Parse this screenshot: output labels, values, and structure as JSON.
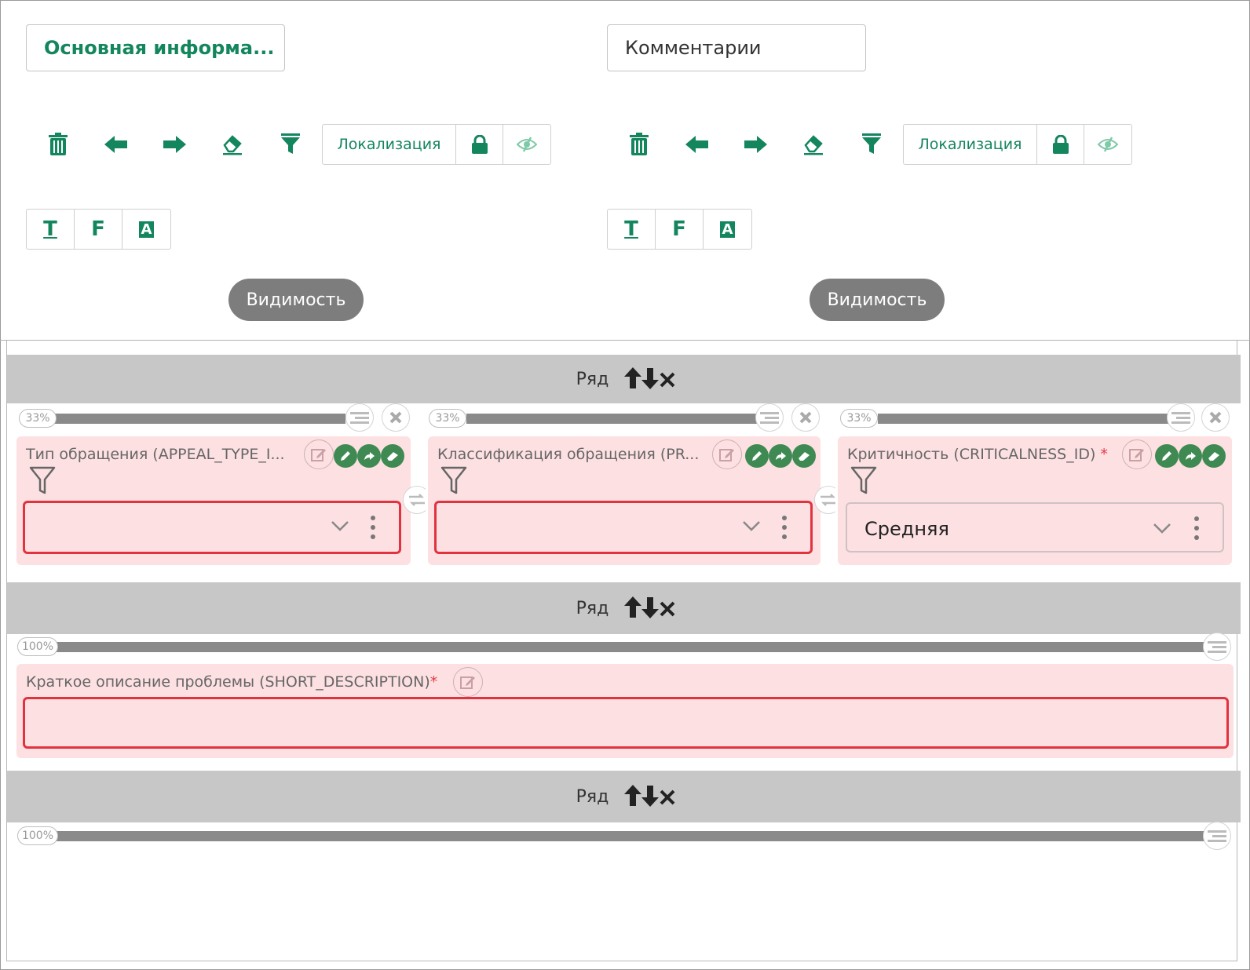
{
  "panels": [
    {
      "tab_label": "Основная информа...",
      "active": true,
      "localization_label": "Локализация",
      "visibility_label": "Видимость"
    },
    {
      "tab_label": "Комментарии",
      "active": false,
      "localization_label": "Локализация",
      "visibility_label": "Видимость"
    }
  ],
  "format_buttons": {
    "text": "T",
    "font": "F",
    "accent": "A"
  },
  "row_label": "Ряд",
  "rows": [
    {
      "columns": [
        {
          "width_pct": "33%",
          "field_label": "Тип обращения (APPEAL_TYPE_I...",
          "value": "",
          "required": true,
          "invalid": true
        },
        {
          "width_pct": "33%",
          "field_label": "Классификация обращения (PR...",
          "value": "",
          "required": true,
          "invalid": true
        },
        {
          "width_pct": "33%",
          "field_label": "Критичность (CRITICALNESS_ID)",
          "required_mark": "*",
          "value": "Средняя",
          "required": true,
          "invalid": false
        }
      ]
    },
    {
      "columns": [
        {
          "width_pct": "100%",
          "field_label": "Краткое описание проблемы (SHORT_DESCRIPTION)",
          "required_mark": "*",
          "value": "",
          "invalid": true
        }
      ]
    },
    {
      "columns": [
        {
          "width_pct": "100%"
        }
      ]
    }
  ],
  "colors": {
    "accent": "#14865e",
    "error_border": "#e23240",
    "field_bg": "#fde0e2",
    "row_bar": "#c7c7c7",
    "pill": "#7d7d7d"
  }
}
